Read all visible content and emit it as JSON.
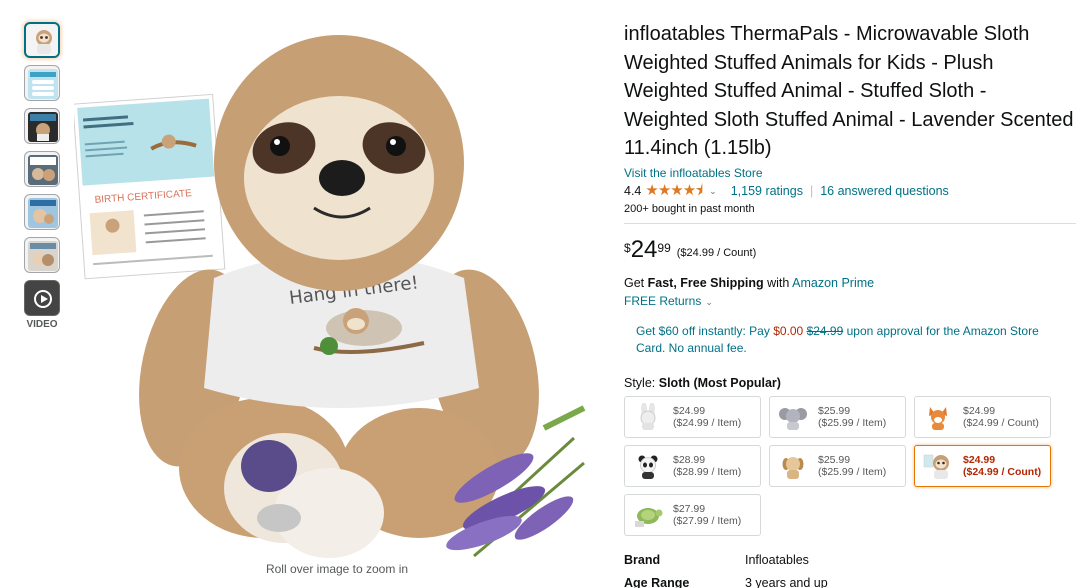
{
  "thumbnails": [
    {
      "name": "thumb-sloth-main",
      "active": true
    },
    {
      "name": "thumb-infographic-1",
      "active": false
    },
    {
      "name": "thumb-lifestyle-1",
      "active": false
    },
    {
      "name": "thumb-lifestyle-2",
      "active": false
    },
    {
      "name": "thumb-lifestyle-3",
      "active": false
    },
    {
      "name": "thumb-lifestyle-4",
      "active": false
    }
  ],
  "video_label": "VIDEO",
  "main_image": {
    "certificate_heading": "BIRTH CERTIFICATE",
    "certificate_intro": "Hello, THANK YOU for taking me home with you!",
    "shirt_text": "Hang in there!"
  },
  "zoom_hint": "Roll over image to zoom in",
  "product": {
    "title": "infloatables ThermaPals - Microwavable Sloth Weighted Stuffed Animals for Kids - Plush Weighted Stuffed Animal - Stuffed Sloth - Weighted Sloth Stuffed Animal - Lavender Scented 11.4inch (1.15lb)",
    "store_link": "Visit the infloatables Store",
    "rating": "4.4",
    "stars_glyph": "★★★★⯨",
    "chevron": "⌄",
    "ratings_count": "1,159 ratings",
    "separator": "|",
    "answered_questions": "16 answered questions",
    "bought": "200+ bought in past month"
  },
  "price": {
    "symbol": "$",
    "whole": "24",
    "fraction": "99",
    "unit": "($24.99 / Count)"
  },
  "shipping": {
    "prefix": "Get ",
    "bold": "Fast, Free Shipping",
    "middle": " with ",
    "link": "Amazon Prime",
    "returns": "FREE Returns"
  },
  "card_offer": {
    "part1": "Get $60 off instantly: Pay ",
    "red": "$0.00",
    "space": " ",
    "strike": "$24.99",
    "part2": " upon approval for the Amazon Store Card. No annual fee."
  },
  "style": {
    "label": "Style: ",
    "value": "Sloth (Most Popular)",
    "options": [
      {
        "icon": "bunny-plush-icon",
        "price": "$24.99",
        "unit": "($24.99 / Item)",
        "selected": false
      },
      {
        "icon": "elephant-plush-icon",
        "price": "$25.99",
        "unit": "($25.99 / Item)",
        "selected": false
      },
      {
        "icon": "fox-plush-icon",
        "price": "$24.99",
        "unit": "($24.99 / Count)",
        "selected": false
      },
      {
        "icon": "panda-plush-icon",
        "price": "$28.99",
        "unit": "($28.99 / Item)",
        "selected": false
      },
      {
        "icon": "puppy-plush-icon",
        "price": "$25.99",
        "unit": "($25.99 / Item)",
        "selected": false
      },
      {
        "icon": "sloth-plush-icon",
        "price": "$24.99",
        "unit": "($24.99 / Count)",
        "selected": true
      },
      {
        "icon": "turtle-plush-icon",
        "price": "$27.99",
        "unit": "($27.99 / Item)",
        "selected": false
      }
    ]
  },
  "details": [
    {
      "key": "Brand",
      "value": "Infloatables"
    },
    {
      "key": "Age Range",
      "value": "3 years and up"
    }
  ],
  "colors": {
    "link": "#007185",
    "star": "#de7921",
    "price_red": "#b12704",
    "selected_border": "#e77600"
  }
}
